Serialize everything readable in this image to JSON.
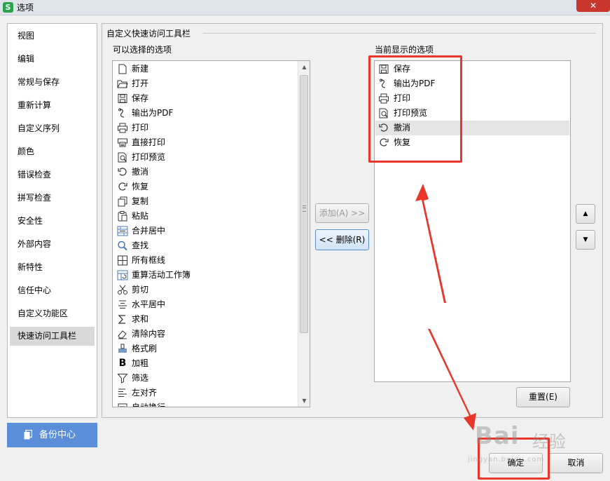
{
  "window": {
    "title": "选项",
    "app_logo": "S",
    "close_icon": "close-icon"
  },
  "nav": {
    "items": [
      {
        "label": "视图"
      },
      {
        "label": "编辑"
      },
      {
        "label": "常规与保存"
      },
      {
        "label": "重新计算"
      },
      {
        "label": "自定义序列"
      },
      {
        "label": "颜色"
      },
      {
        "label": "错误检查"
      },
      {
        "label": "拼写检查"
      },
      {
        "label": "安全性"
      },
      {
        "label": "外部内容"
      },
      {
        "label": "新特性"
      },
      {
        "label": "信任中心"
      },
      {
        "label": "自定义功能区"
      },
      {
        "label": "快速访问工具栏",
        "active": true
      }
    ],
    "backup_label": "备份中心"
  },
  "main": {
    "section_title": "自定义快速访问工具栏",
    "available_title": "可以选择的选项",
    "current_title": "当前显示的选项",
    "available_items": [
      {
        "label": "新建",
        "icon": "new-file-icon"
      },
      {
        "label": "打开",
        "icon": "folder-open-icon"
      },
      {
        "label": "保存",
        "icon": "save-icon"
      },
      {
        "label": "输出为PDF",
        "icon": "pdf-export-icon"
      },
      {
        "label": "打印",
        "icon": "print-icon"
      },
      {
        "label": "直接打印",
        "icon": "direct-print-icon"
      },
      {
        "label": "打印预览",
        "icon": "print-preview-icon"
      },
      {
        "label": "撤消",
        "icon": "undo-icon"
      },
      {
        "label": "恢复",
        "icon": "redo-icon"
      },
      {
        "label": "复制",
        "icon": "copy-icon"
      },
      {
        "label": "粘贴",
        "icon": "paste-icon"
      },
      {
        "label": "合并居中",
        "icon": "merge-center-icon"
      },
      {
        "label": "查找",
        "icon": "search-icon"
      },
      {
        "label": "所有框线",
        "icon": "all-borders-icon"
      },
      {
        "label": "重算活动工作簿",
        "icon": "recalculate-icon"
      },
      {
        "label": "剪切",
        "icon": "cut-icon"
      },
      {
        "label": "水平居中",
        "icon": "align-center-icon"
      },
      {
        "label": "求和",
        "icon": "sum-icon"
      },
      {
        "label": "清除内容",
        "icon": "eraser-icon"
      },
      {
        "label": "格式刷",
        "icon": "format-painter-icon"
      },
      {
        "label": "加粗",
        "icon": "bold-icon"
      },
      {
        "label": "筛选",
        "icon": "filter-icon"
      },
      {
        "label": "左对齐",
        "icon": "align-left-icon"
      },
      {
        "label": "自动换行",
        "icon": "wrap-text-icon"
      }
    ],
    "current_items": [
      {
        "label": "保存",
        "icon": "save-icon"
      },
      {
        "label": "输出为PDF",
        "icon": "pdf-export-icon"
      },
      {
        "label": "打印",
        "icon": "print-icon"
      },
      {
        "label": "打印预览",
        "icon": "print-preview-icon"
      },
      {
        "label": "撤消",
        "icon": "undo-icon",
        "selected": true
      },
      {
        "label": "恢复",
        "icon": "redo-icon"
      }
    ],
    "add_label": "添加(A) >>",
    "remove_label": "<< 删除(R)",
    "reset_label": "重置(E)",
    "move_up_icon": "▲",
    "move_down_icon": "▼"
  },
  "footer": {
    "ok_label": "确定",
    "cancel_label": "取消"
  },
  "watermark": {
    "logo": "Bai",
    "text": "经验",
    "url": "jingyan.baidu.com"
  },
  "colors": {
    "accent": "#5b8ed8",
    "annotation": "#e8362b",
    "close": "#c9362c",
    "logo": "#2aa34a"
  }
}
